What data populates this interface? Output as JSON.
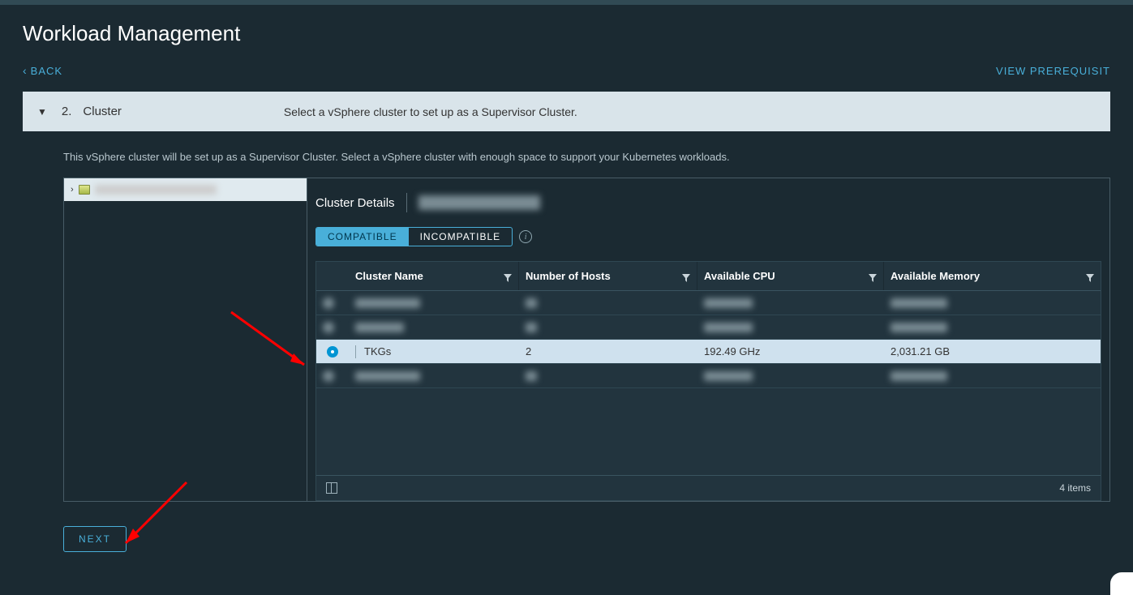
{
  "page": {
    "title": "Workload Management",
    "back_label": "BACK",
    "prereq_label": "VIEW PREREQUISIT"
  },
  "step": {
    "number": "2.",
    "name": "Cluster",
    "description": "Select a vSphere cluster to set up as a Supervisor Cluster."
  },
  "help_text": "This vSphere cluster will be set up as a Supervisor Cluster. Select a vSphere cluster with enough space to support your Kubernetes workloads.",
  "details": {
    "title": "Cluster Details",
    "tab_compatible": "COMPATIBLE",
    "tab_incompatible": "INCOMPATIBLE"
  },
  "table": {
    "columns": [
      "Cluster Name",
      "Number of Hosts",
      "Available CPU",
      "Available Memory"
    ],
    "rows": [
      {
        "selected": false,
        "redacted": true,
        "name": "",
        "hosts": "",
        "cpu": "",
        "memory": ""
      },
      {
        "selected": false,
        "redacted": true,
        "name": "",
        "hosts": "",
        "cpu": "",
        "memory": ""
      },
      {
        "selected": true,
        "redacted": false,
        "name": "TKGs",
        "hosts": "2",
        "cpu": "192.49 GHz",
        "memory": "2,031.21 GB"
      },
      {
        "selected": false,
        "redacted": true,
        "name": "",
        "hosts": "",
        "cpu": "",
        "memory": ""
      }
    ],
    "footer_count": "4 items"
  },
  "next_label": "NEXT"
}
